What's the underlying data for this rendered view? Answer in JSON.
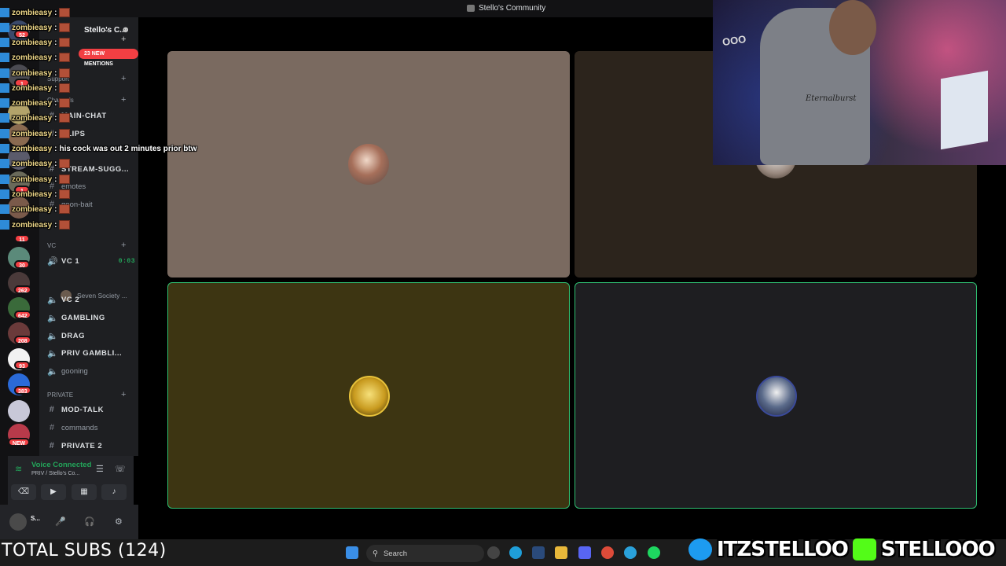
{
  "window": {
    "title": "Stello's Community"
  },
  "server": {
    "name": "Stello's C...",
    "mentions": "23 NEW MENTIONS"
  },
  "rail": {
    "badges": [
      "52",
      "1",
      "1",
      "11",
      "30",
      "262",
      "642",
      "208",
      "93",
      "383",
      "NEW"
    ]
  },
  "categories": {
    "support": "Support",
    "channels": "Channels",
    "vc": "VC",
    "private": "PRIVATE"
  },
  "channels": [
    {
      "name": "MAIN-CHAT",
      "icon": "#"
    },
    {
      "name": "CLIPS",
      "icon": "#"
    },
    {
      "name": "STREAM-SUGG...",
      "icon": "#"
    },
    {
      "name": "emotes",
      "icon": "#"
    },
    {
      "name": "goon-bait",
      "icon": "#"
    }
  ],
  "voice_channels": [
    {
      "name": "VC 1",
      "timer": "0:03"
    },
    {
      "name": "VC 2"
    },
    {
      "name": "GAMBLING"
    },
    {
      "name": "DRAG"
    },
    {
      "name": "PRIV GAMBLI..."
    },
    {
      "name": "gooning"
    }
  ],
  "voice_user": "Seven Society ...",
  "private_channels": [
    {
      "name": "MOD-TALK"
    },
    {
      "name": "commands"
    },
    {
      "name": "PRIVATE 2"
    }
  ],
  "voice_panel": {
    "status": "Voice Connected",
    "location": "PRIV / Stello's Co..."
  },
  "user_panel": {
    "name": "S..."
  },
  "chat": [
    {
      "user": "zombieasy",
      "text": ""
    },
    {
      "user": "zombieasy",
      "text": ""
    },
    {
      "user": "zombieasy",
      "text": ""
    },
    {
      "user": "zombieasy",
      "text": ""
    },
    {
      "user": "zombieasy",
      "text": ""
    },
    {
      "user": "zombieasy",
      "text": ""
    },
    {
      "user": "zombieasy",
      "text": ""
    },
    {
      "user": "zombieasy",
      "text": ""
    },
    {
      "user": "zombieasy",
      "text": ""
    },
    {
      "user": "zombieasy",
      "text": "his cock was out 2 minutes prior btw"
    },
    {
      "user": "zombieasy",
      "text": ""
    },
    {
      "user": "zombieasy",
      "text": ""
    },
    {
      "user": "zombieasy",
      "text": ""
    },
    {
      "user": "zombieasy",
      "text": ""
    },
    {
      "user": "zombieasy",
      "text": ""
    }
  ],
  "webcam": {
    "sign": "OOO",
    "hoodie": "Eternalburst"
  },
  "taskbar": {
    "search": "Search"
  },
  "overlay": {
    "subs": "TOTAL SUBS (124)",
    "twitter": "ITZSTELLOO",
    "kick": "STELLOOO"
  },
  "colors": {
    "accent": "#23a55a",
    "mention": "#f23f43",
    "twitter": "#1d9bf0",
    "kick": "#53fc18"
  }
}
